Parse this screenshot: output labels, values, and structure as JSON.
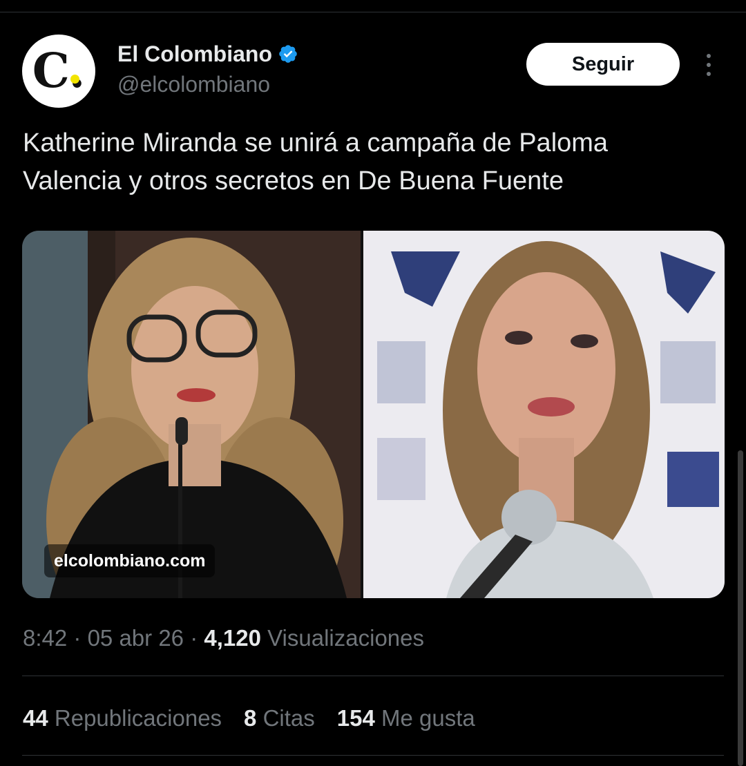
{
  "account": {
    "display_name": "El Colombiano",
    "handle": "@elcolombiano",
    "avatar_letter": "C.",
    "avatar_dot_color": "#f2e400",
    "verified_icon": "verified-badge-icon",
    "verified_color": "#1d9bf0"
  },
  "actions": {
    "follow_label": "Seguir",
    "more_icon": "more-vertical-icon"
  },
  "tweet": {
    "text": "Katherine Miranda se unirá a campaña de Paloma Valencia y otros secretos en De Buena Fuente"
  },
  "media": {
    "watermark": "elcolombiano.com"
  },
  "meta": {
    "time": "8:42",
    "sep1": "·",
    "date": "05 abr 26",
    "sep2": "·",
    "views_count": "4,120",
    "views_label": "Visualizaciones"
  },
  "stats": {
    "reposts_count": "44",
    "reposts_label": "Republicaciones",
    "quotes_count": "8",
    "quotes_label": "Citas",
    "likes_count": "154",
    "likes_label": "Me gusta"
  },
  "colors": {
    "background": "#000000",
    "primary_text": "#e7e9ea",
    "secondary_text": "#71767b",
    "divider": "#2f3336"
  }
}
